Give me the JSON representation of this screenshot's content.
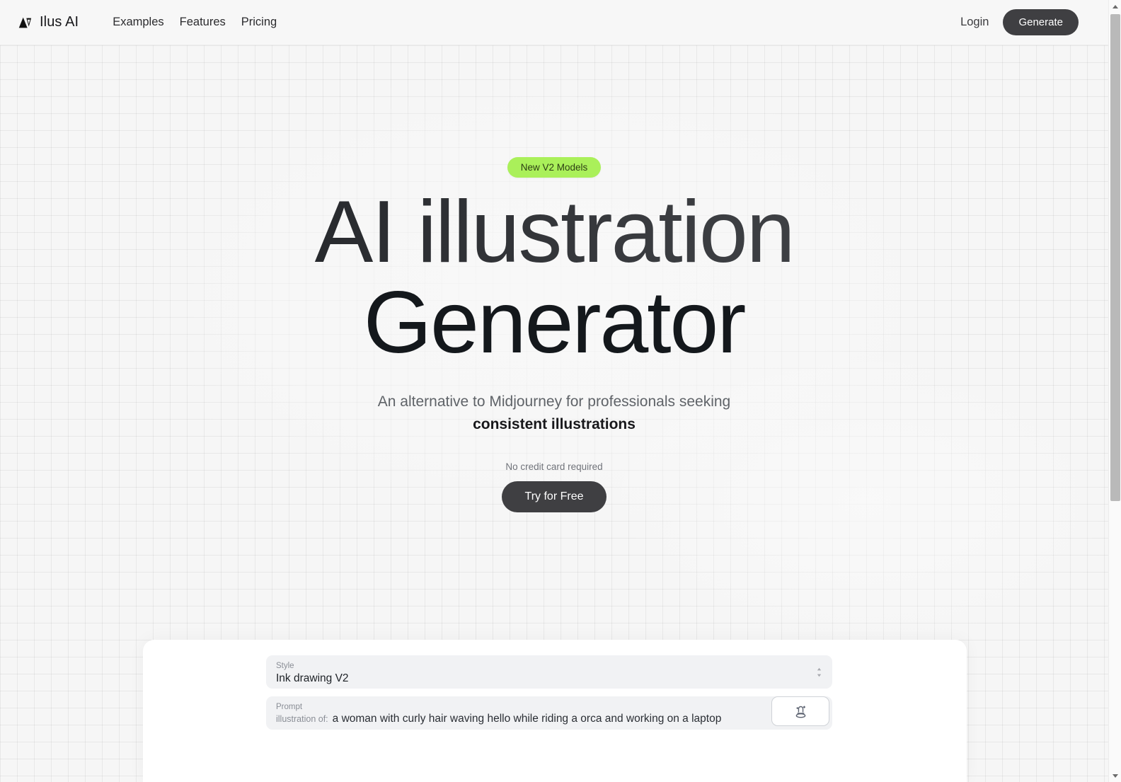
{
  "theme": {
    "page_bg": "#f7f7f7",
    "accent_green": "#aaf05a",
    "button_dark": "#3f3f42",
    "card_bg": "#ffffff",
    "field_bg": "#f1f2f4",
    "text_dark": "#18181b",
    "text_muted": "#8a8e96"
  },
  "navbar": {
    "logo_icon": "ilus-ai-logo-icon",
    "brand": "Ilus AI",
    "links": [
      {
        "label": "Examples"
      },
      {
        "label": "Features"
      },
      {
        "label": "Pricing"
      }
    ],
    "login_label": "Login",
    "generate_label": "Generate"
  },
  "hero": {
    "badge": "New V2 Models",
    "headline_line1": "AI illustration",
    "headline_line2": "Generator",
    "subtitle_lead": "An alternative to Midjourney for professionals seeking",
    "subtitle_strong": "consistent illustrations",
    "no_credit_card": "No credit card required",
    "cta_label": "Try for Free"
  },
  "form": {
    "style": {
      "label": "Style",
      "value": "Ink drawing V2",
      "chevron_icon": "chevron-up-down-icon"
    },
    "prompt": {
      "label": "Prompt",
      "prefix": "illustration of:",
      "value": "a woman with curly hair waving hello while riding a orca and working on a laptop",
      "placeholder": "a woman with curly hair waving hello while riding a orca and working on a laptop"
    },
    "magic_button": {
      "icon": "magic-hat-icon",
      "label": ""
    }
  },
  "scrollbar": {
    "up_icon": "scroll-up-arrow-icon",
    "down_icon": "scroll-down-arrow-icon"
  }
}
